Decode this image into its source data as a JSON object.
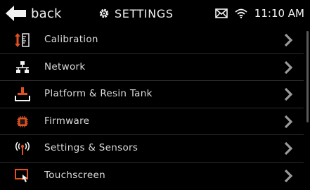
{
  "header": {
    "back_label": "back",
    "title": "SETTINGS",
    "time": "11:10 AM"
  },
  "menu": {
    "items": [
      {
        "label": "Calibration",
        "icon": "calibration-icon"
      },
      {
        "label": "Network",
        "icon": "network-icon"
      },
      {
        "label": "Platform & Resin Tank",
        "icon": "platform-icon"
      },
      {
        "label": "Firmware",
        "icon": "firmware-chip-icon"
      },
      {
        "label": "Settings & Sensors",
        "icon": "sensor-signal-icon"
      },
      {
        "label": "Touchscreen",
        "icon": "touchscreen-icon"
      }
    ]
  },
  "colors": {
    "background": "#000000",
    "accent": "#e2501f",
    "text": "#e8e8e8",
    "divider": "#2c2c2c",
    "chevron": "#9a9a9a"
  }
}
